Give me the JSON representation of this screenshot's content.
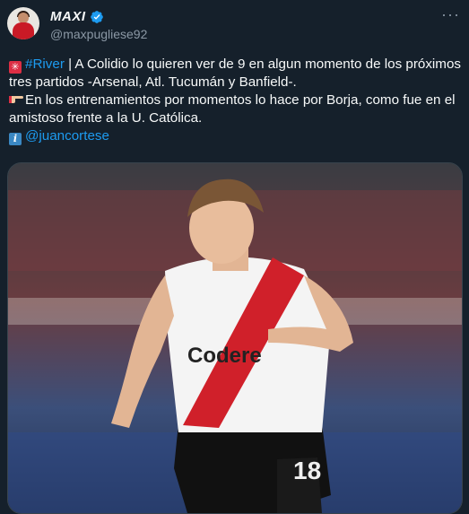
{
  "author": {
    "display_name": "MAXI",
    "handle": "@maxpugliese92",
    "verified": true
  },
  "menu_icon": "more-icon",
  "tweet": {
    "line1_hashtag": "#River",
    "line1_text": " | A Colidio lo quieren ver de 9 en algun momento de los próximos tres partidos -Arsenal, Atl. Tucumán y Banfield-.",
    "line2_text": "En los entrenamientos por momentos lo hace por Borja, como fue en el amistoso frente a la U. Católica.",
    "line3_mention": "@juancortese"
  },
  "media": {
    "shirt_text": "Codere",
    "shirt_number": "18"
  },
  "colors": {
    "background": "#15202b",
    "link": "#1d9bf0",
    "secondary_text": "#8b98a5",
    "verified": "#1d9bf0"
  }
}
